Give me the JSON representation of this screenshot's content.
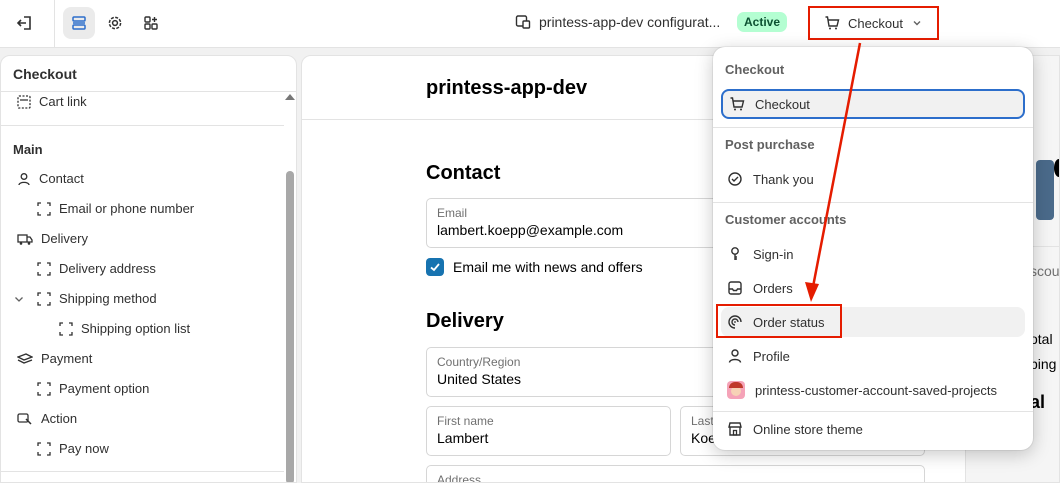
{
  "topbar": {
    "store_title": "printess-app-dev configurat...",
    "status_badge": "Active",
    "checkout_dropdown_label": "Checkout"
  },
  "left_panel": {
    "title": "Checkout",
    "cart_link": "Cart link",
    "main_section": "Main",
    "items": {
      "contact": "Contact",
      "email_or_phone": "Email or phone number",
      "delivery": "Delivery",
      "delivery_address": "Delivery address",
      "shipping_method": "Shipping method",
      "shipping_option_list": "Shipping option list",
      "payment": "Payment",
      "payment_option": "Payment option",
      "action": "Action",
      "pay_now": "Pay now"
    }
  },
  "preview": {
    "shop_name": "printess-app-dev",
    "contact_heading": "Contact",
    "email_label": "Email",
    "email_value": "lambert.koepp@example.com",
    "newsletter_label": "Email me with news and offers",
    "delivery_heading": "Delivery",
    "country_label": "Country/Region",
    "country_value": "United States",
    "first_name_label": "First name",
    "first_name_value": "Lambert",
    "last_name_label": "Last",
    "last_name_value": "Koe",
    "address_label": "Address",
    "right_discount": "scou",
    "right_subtotal": "otal",
    "right_shipping": "ping",
    "right_total": "al"
  },
  "dropdown": {
    "sections": {
      "checkout": "Checkout",
      "post_purchase": "Post purchase",
      "customer_accounts": "Customer accounts"
    },
    "items": {
      "checkout": "Checkout",
      "thank_you": "Thank you",
      "sign_in": "Sign-in",
      "orders": "Orders",
      "order_status": "Order status",
      "profile": "Profile",
      "saved_projects": "printess-customer-account-saved-projects",
      "online_store_theme": "Online store theme"
    }
  },
  "colors": {
    "accent_blue": "#2c6ecb",
    "checkbox_blue": "#1773b0",
    "annotation_red": "#e51c00",
    "active_badge_bg": "#b4fed2",
    "active_badge_text": "#0c5132"
  }
}
